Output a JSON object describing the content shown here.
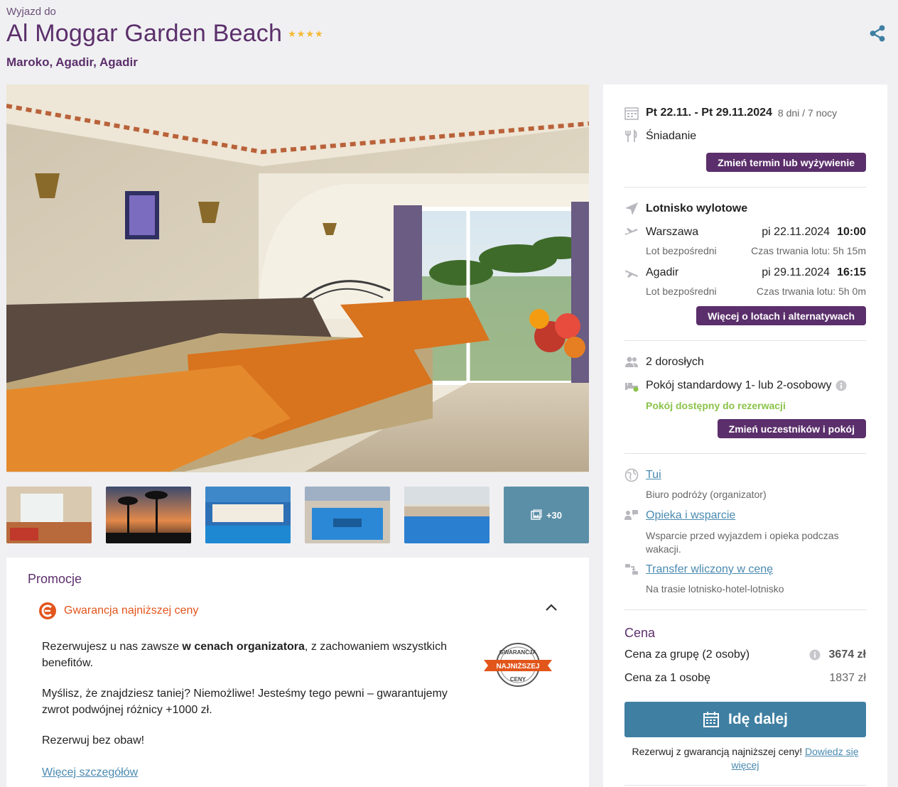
{
  "header": {
    "pre_title": "Wyjazd do",
    "title": "Al Moggar Garden Beach",
    "stars": "★★★★",
    "location": "Maroko, Agadir, Agadir"
  },
  "gallery": {
    "more_count": "+30"
  },
  "promo": {
    "heading": "Promocje",
    "guarantee": "Gwarancja najniższej ceny",
    "p1_a": "Rezerwujesz u nas zawsze ",
    "p1_b": "w cenach organizatora",
    "p1_c": ", z zachowaniem wszystkich benefitów.",
    "p2": "Myślisz, że znajdziesz taniej? Niemożliwe! Jesteśmy tego pewni – gwarantujemy zwrot podwójnej różnicy +1000 zł.",
    "p3": "Rezerwuj bez obaw!",
    "more_link": "Więcej szczegółów",
    "badge_top": "GWARANCJA",
    "badge_mid": "NAJNIŻSZEJ",
    "badge_bot": "CENY"
  },
  "side": {
    "dates": "Pt 22.11. - Pt 29.11.2024",
    "duration": "8 dni / 7 nocy",
    "board": "Śniadanie",
    "change_term_btn": "Zmień termin lub wyżywienie",
    "airport_title": "Lotnisko wylotowe",
    "outbound": {
      "city": "Warszawa",
      "date": "pi 22.11.2024",
      "time": "10:00",
      "type": "Lot bezpośredni",
      "duration": "Czas trwania lotu: 5h 15m"
    },
    "inbound": {
      "city": "Agadir",
      "date": "pi 29.11.2024",
      "time": "16:15",
      "type": "Lot bezpośredni",
      "duration": "Czas trwania lotu: 5h 0m"
    },
    "flights_btn": "Więcej o lotach i alternatywach",
    "participants": "2 dorosłych",
    "room": "Pokój standardowy 1- lub 2-osobowy",
    "room_status": "Pokój dostępny do rezerwacji",
    "change_room_btn": "Zmień uczestników i pokój",
    "organizer": "Tui",
    "organizer_desc": "Biuro podróży (organizator)",
    "support": "Opieka i wsparcie",
    "support_desc": "Wsparcie przed wyjazdem i opieka podczas wakacji.",
    "transfer": "Transfer wliczony w cenę",
    "transfer_desc": "Na trasie lotnisko-hotel-lotnisko",
    "price_title": "Cena",
    "group_label": "Cena za grupę (2 osoby)",
    "group_price": "3674 zł",
    "person_label": "Cena za 1 osobę",
    "person_price": "1837 zł",
    "go_btn": "Idę dalej",
    "footer_text": "Rezerwuj z gwarancją najniższej ceny!",
    "footer_link_1": "Dowiedz się",
    "footer_link_2": "więcej"
  },
  "colors": {
    "brand": "#5b2f6b",
    "accent": "#3f7fa2",
    "orange": "#e2551b",
    "available": "#8bc34a"
  }
}
